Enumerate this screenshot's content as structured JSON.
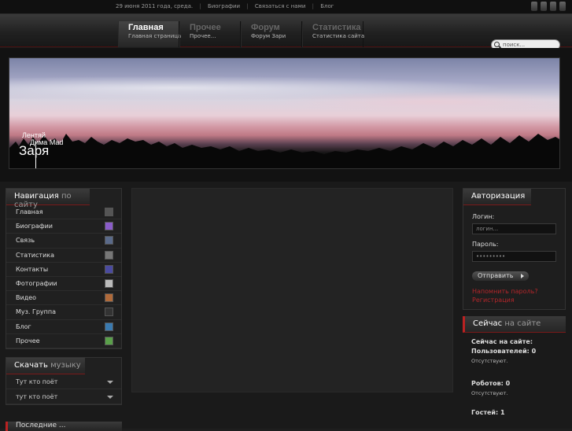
{
  "topbar": {
    "date": "29 июня 2011 года, среда.",
    "links": [
      "Биографии",
      "Связаться с нами",
      "Блог"
    ]
  },
  "menu": [
    {
      "title": "Главная",
      "subtitle": "Главная страница"
    },
    {
      "title": "Прочее",
      "subtitle": "Прочее..."
    },
    {
      "title": "Форум",
      "subtitle": "Форум Зари"
    },
    {
      "title": "Статистика",
      "subtitle": "Статистика сайта"
    }
  ],
  "search": {
    "placeholder": "поиск..."
  },
  "banner": {
    "small_line1": "Лентяй",
    "small_line2": "Дима Mad",
    "logo": "Заря"
  },
  "navigation": {
    "title": "Навигация",
    "title_sub": "по сайту",
    "items": [
      "Главная",
      "Биографии",
      "Связь",
      "Статистика",
      "Контакты",
      "Фотографии",
      "Видео",
      "Муз. Группа",
      "Блог",
      "Прочее"
    ]
  },
  "download": {
    "title": "Скачать",
    "title_sub": "музыку",
    "items": [
      "Тут кто поёт",
      "тут кто поёт"
    ]
  },
  "auth": {
    "title": "Авторизация",
    "login_label": "Логин:",
    "login_placeholder": "логин...",
    "password_label": "Пароль:",
    "password_value": "•••••••••",
    "submit": "Отправить",
    "forgot": "Напомнить пароль?",
    "register": "Регистрация"
  },
  "online": {
    "title": "Сейчас",
    "title_sub": "на сайте",
    "now_label": "Сейчас на сайте:",
    "users": "Пользователей: 0",
    "users_absent": "Отсутствуют.",
    "robots": "Роботов: 0",
    "robots_absent": "Отсутствуют.",
    "guests": "Гостей: 1"
  },
  "bottom_left": {
    "title": "Последние ..."
  },
  "colors": {
    "accent_red": "#b3262a",
    "bg": "#1e1e1e"
  }
}
